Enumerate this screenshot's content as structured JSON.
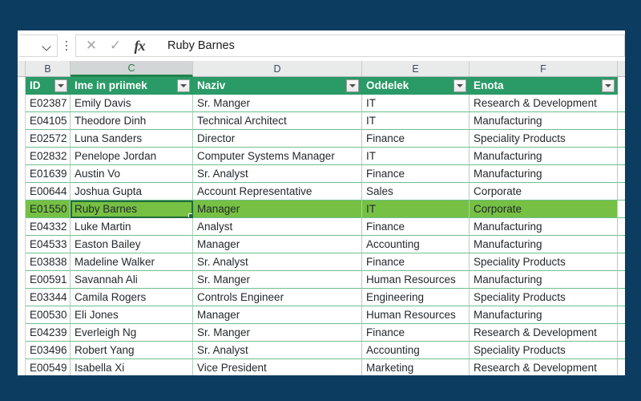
{
  "window": {
    "background_color": "#0d3c61",
    "app": "spreadsheet"
  },
  "formula_bar": {
    "name_box_value": "",
    "name_box_icon": "chevron-down-icon",
    "kebab_icon": "more-options-icon",
    "cancel_icon": "✕",
    "enter_icon": "✓",
    "fx_label": "fx",
    "value": "Ruby Barnes"
  },
  "column_headers": [
    {
      "letter": "B",
      "active": false
    },
    {
      "letter": "C",
      "active": true
    },
    {
      "letter": "D",
      "active": false
    },
    {
      "letter": "E",
      "active": false
    },
    {
      "letter": "F",
      "active": false
    }
  ],
  "table": {
    "header_color": "#2a9a67",
    "selected_row_color": "#76c043",
    "active_cell": "C",
    "columns": [
      "ID",
      "Ime in priimek",
      "Naziv",
      "Oddelek",
      "Enota"
    ],
    "rows": [
      {
        "id": "E02387",
        "name": "Emily Davis",
        "title": "Sr. Manger",
        "dept": "IT",
        "unit": "Research & Development",
        "selected": false
      },
      {
        "id": "E04105",
        "name": "Theodore Dinh",
        "title": "Technical Architect",
        "dept": "IT",
        "unit": "Manufacturing",
        "selected": false
      },
      {
        "id": "E02572",
        "name": "Luna Sanders",
        "title": "Director",
        "dept": "Finance",
        "unit": "Speciality Products",
        "selected": false
      },
      {
        "id": "E02832",
        "name": "Penelope Jordan",
        "title": "Computer Systems Manager",
        "dept": "IT",
        "unit": "Manufacturing",
        "selected": false
      },
      {
        "id": "E01639",
        "name": "Austin Vo",
        "title": "Sr. Analyst",
        "dept": "Finance",
        "unit": "Manufacturing",
        "selected": false
      },
      {
        "id": "E00644",
        "name": "Joshua Gupta",
        "title": "Account Representative",
        "dept": "Sales",
        "unit": "Corporate",
        "selected": false
      },
      {
        "id": "E01550",
        "name": "Ruby Barnes",
        "title": "Manager",
        "dept": "IT",
        "unit": "Corporate",
        "selected": true
      },
      {
        "id": "E04332",
        "name": "Luke Martin",
        "title": "Analyst",
        "dept": "Finance",
        "unit": "Manufacturing",
        "selected": false
      },
      {
        "id": "E04533",
        "name": "Easton Bailey",
        "title": "Manager",
        "dept": "Accounting",
        "unit": "Manufacturing",
        "selected": false
      },
      {
        "id": "E03838",
        "name": "Madeline Walker",
        "title": "Sr. Analyst",
        "dept": "Finance",
        "unit": "Speciality Products",
        "selected": false
      },
      {
        "id": "E00591",
        "name": "Savannah Ali",
        "title": "Sr. Manger",
        "dept": "Human Resources",
        "unit": "Manufacturing",
        "selected": false
      },
      {
        "id": "E03344",
        "name": "Camila Rogers",
        "title": "Controls Engineer",
        "dept": "Engineering",
        "unit": "Speciality Products",
        "selected": false
      },
      {
        "id": "E00530",
        "name": "Eli Jones",
        "title": "Manager",
        "dept": "Human Resources",
        "unit": "Manufacturing",
        "selected": false
      },
      {
        "id": "E04239",
        "name": "Everleigh Ng",
        "title": "Sr. Manger",
        "dept": "Finance",
        "unit": "Research & Development",
        "selected": false
      },
      {
        "id": "E03496",
        "name": "Robert Yang",
        "title": "Sr. Analyst",
        "dept": "Accounting",
        "unit": "Speciality Products",
        "selected": false
      },
      {
        "id": "E00549",
        "name": "Isabella Xi",
        "title": "Vice President",
        "dept": "Marketing",
        "unit": "Research & Development",
        "selected": false
      }
    ]
  }
}
